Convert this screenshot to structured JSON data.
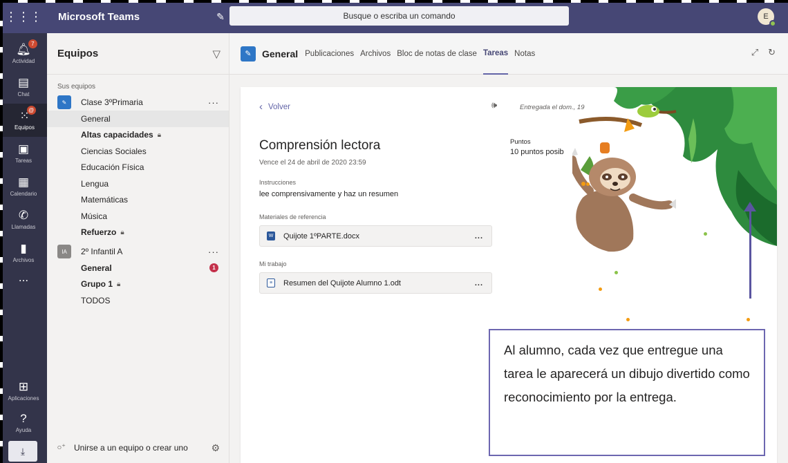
{
  "topbar": {
    "app_title": "Microsoft Teams",
    "search_placeholder": "Busque o escriba un comando",
    "avatar_initial": "E"
  },
  "appbar": {
    "items": [
      {
        "label": "Actividad",
        "icon": "bell-icon",
        "badge": "7"
      },
      {
        "label": "Chat",
        "icon": "chat-icon"
      },
      {
        "label": "Equipos",
        "icon": "teams-icon",
        "badge": "@"
      },
      {
        "label": "Tareas",
        "icon": "assignments-icon"
      },
      {
        "label": "Calendario",
        "icon": "calendar-icon"
      },
      {
        "label": "Llamadas",
        "icon": "phone-icon"
      },
      {
        "label": "Archivos",
        "icon": "files-icon"
      },
      {
        "label": "...",
        "icon": "more-icon"
      }
    ],
    "bottom_items": [
      {
        "label": "Aplicaciones",
        "icon": "apps-icon"
      },
      {
        "label": "Ayuda",
        "icon": "help-icon"
      }
    ]
  },
  "teams_panel": {
    "title": "Equipos",
    "section_label": "Sus equipos",
    "teams": [
      {
        "name": "Clase 3ºPrimaria",
        "channels": [
          {
            "name": "General",
            "selected": true
          },
          {
            "name": "Altas capacidades",
            "bold": true,
            "locked": true
          },
          {
            "name": "Ciencias Sociales"
          },
          {
            "name": "Educación Física"
          },
          {
            "name": "Lengua"
          },
          {
            "name": "Matemáticas"
          },
          {
            "name": "Música"
          },
          {
            "name": "Refuerzo",
            "bold": true,
            "locked": true
          }
        ]
      },
      {
        "name": "2º Infantil A",
        "avatar": "IA",
        "channels": [
          {
            "name": "General",
            "bold": true,
            "mention": "1"
          },
          {
            "name": "Grupo 1",
            "bold": true,
            "locked": true
          },
          {
            "name": "TODOS"
          }
        ]
      }
    ],
    "join_label": "Unirse a un equipo o crear uno"
  },
  "channel_header": {
    "name": "General",
    "tabs": [
      "Publicaciones",
      "Archivos",
      "Bloc de notas de clase",
      "Tareas",
      "Notas"
    ],
    "active_tab": "Tareas"
  },
  "assignment": {
    "back_label": "Volver",
    "submitted_text": "Entregada el dom., 19",
    "points_label": "Puntos",
    "points_value": "10 puntos posib",
    "title": "Comprensión lectora",
    "due": "Vence el 24 de abril de 2020 23:59",
    "instructions_label": "Instrucciones",
    "instructions_text": "lee comprensivamente y haz un resumen",
    "reference_label": "Materiales de referencia",
    "reference_files": [
      {
        "name": "Quijote 1ºPARTE.docx",
        "more": "..."
      }
    ],
    "my_work_label": "Mi trabajo",
    "work_files": [
      {
        "name": "Resumen del Quijote Alumno 1.odt",
        "more": "..."
      }
    ]
  },
  "callout": {
    "text": "Al alumno, cada vez que entregue una tarea le aparecerá un dibujo divertido como reconocimiento por la entrega."
  }
}
